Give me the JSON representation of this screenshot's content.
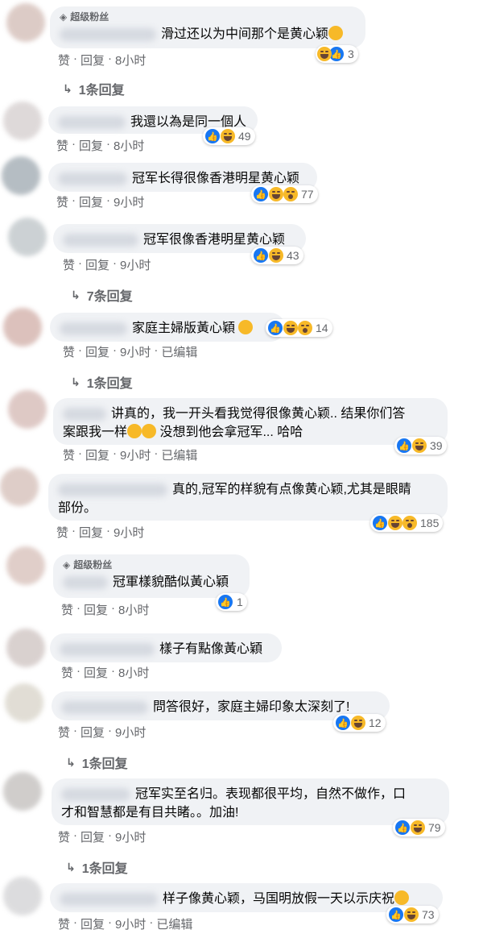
{
  "super_fan_label": "超级粉丝",
  "actions": {
    "like": "赞",
    "reply": "回复",
    "edited": "已编辑"
  },
  "comments": [
    {
      "text": "滑过还以为中间那个是黄心颖",
      "time": "8小时",
      "count": "3",
      "replies": "1条回复"
    },
    {
      "text": "我還以為是同一個人",
      "time": "8小时",
      "count": "49"
    },
    {
      "text": "冠军长得很像香港明星黄心颖",
      "time": "9小时",
      "count": "77"
    },
    {
      "text": "冠军很像香港明星黄心颖",
      "time": "9小时",
      "count": "43",
      "replies": "7条回复"
    },
    {
      "text": "家庭主婦版黃心穎",
      "time": "9小时",
      "count": "14",
      "replies": "1条回复"
    },
    {
      "line1": "讲真的，我一开头看我觉得很像黄心颖.. 结果你们答",
      "line2": "案跟我一样",
      "line2b": "没想到他会拿冠军... 哈哈",
      "time": "9小时",
      "count": "39"
    },
    {
      "line1": "真的,冠军的样貌有点像黄心颖,尤其是眼睛",
      "line2": "部份。",
      "time": "9小时",
      "count": "185"
    },
    {
      "text": "冠軍樣貌酷似黃心穎",
      "time": "8小时",
      "count": "1"
    },
    {
      "text": "樣子有點像黃心穎",
      "time": "8小时"
    },
    {
      "text": "問答很好，家庭主婦印象太深刻了!",
      "time": "9小时",
      "count": "12",
      "replies": "1条回复"
    },
    {
      "line1": "冠军实至名归。表现都很平均，自然不做作，口",
      "line2": "才和智慧都是有目共睹。。加油!",
      "time": "9小时",
      "count": "79",
      "replies": "1条回复"
    },
    {
      "text": "样子像黄心颖，马国明放假一天以示庆祝",
      "time": "9小时",
      "count": "73"
    }
  ]
}
